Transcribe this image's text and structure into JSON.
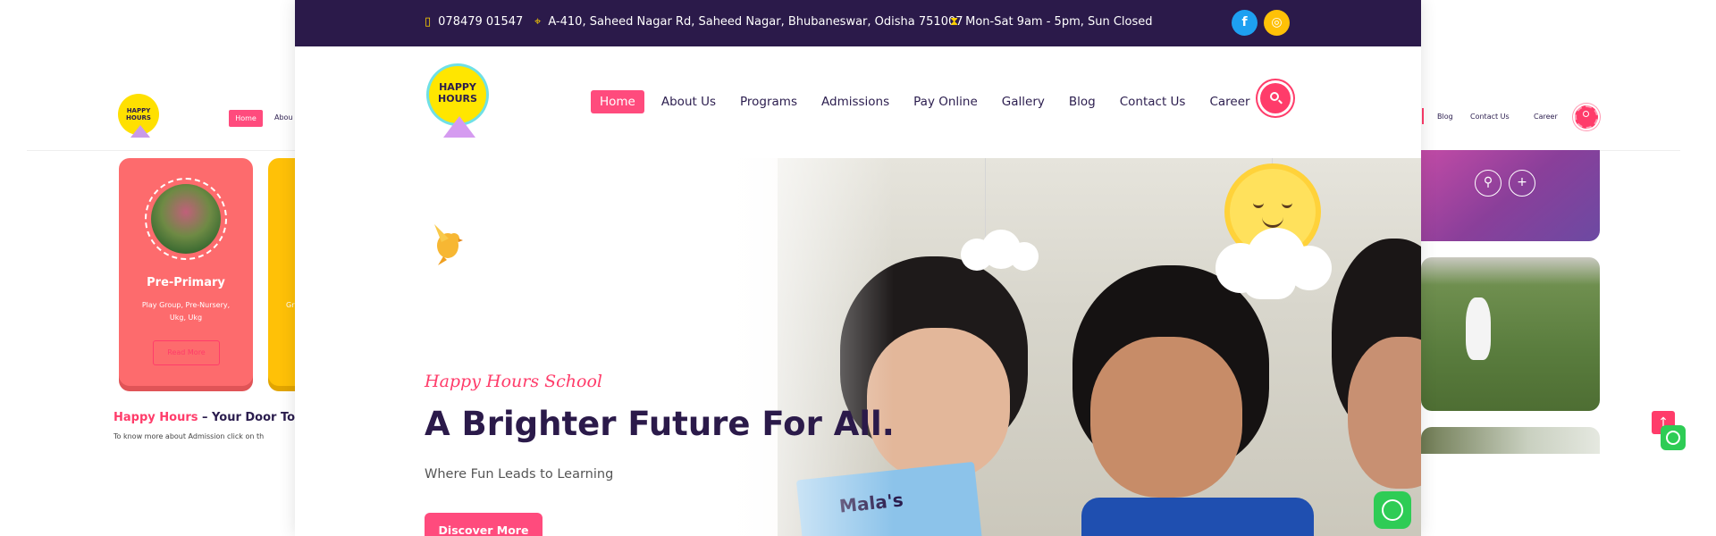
{
  "colors": {
    "brand_dark": "#2b1a4a",
    "accent_pink": "#ff4b7d",
    "accent_yellow": "#ffc107",
    "facebook": "#1ea0f1"
  },
  "topbar": {
    "phone": "078479 01547",
    "address": "A-410, Saheed Nagar Rd, Saheed Nagar, Bhubaneswar, Odisha 751007",
    "hours": "Mon-Sat 9am - 5pm, Sun Closed",
    "facebook_icon": "f",
    "instagram_icon": "◎"
  },
  "logo": {
    "line1": "HAPPY",
    "line2": "HOURS"
  },
  "nav": {
    "items": [
      {
        "label": "Home",
        "active": true
      },
      {
        "label": "About Us"
      },
      {
        "label": "Programs"
      },
      {
        "label": "Admissions"
      },
      {
        "label": "Pay Online"
      },
      {
        "label": "Gallery"
      },
      {
        "label": "Blog"
      },
      {
        "label": "Contact Us"
      },
      {
        "label": "Career"
      }
    ]
  },
  "hero": {
    "subtitle": "Happy Hours School",
    "title": "A Brighter Future For All.",
    "description": "Where Fun Leads to Learning",
    "cta": "Discover More",
    "book_text": "Mala's"
  },
  "bg_left": {
    "logo_line1": "HAPPY",
    "logo_line2": "HOURS",
    "nav_home": "Home",
    "nav_about": "Abou",
    "card_title": "Pre-Primary",
    "card_subtitle": "Play Group, Pre-Nursery, Ukg, Ukg",
    "card_button": "Read More",
    "card2_fragment": "Gr",
    "tagline_pink": "Happy Hours",
    "tagline_dark": " – Your Door To T",
    "tagline_text": "To know more about Admission click on th"
  },
  "bg_right": {
    "nav_items": [
      "Blog",
      "Contact Us",
      "Career"
    ],
    "link_icon": "⚲",
    "plus_icon": "+",
    "scroll_top_icon": "↑"
  }
}
